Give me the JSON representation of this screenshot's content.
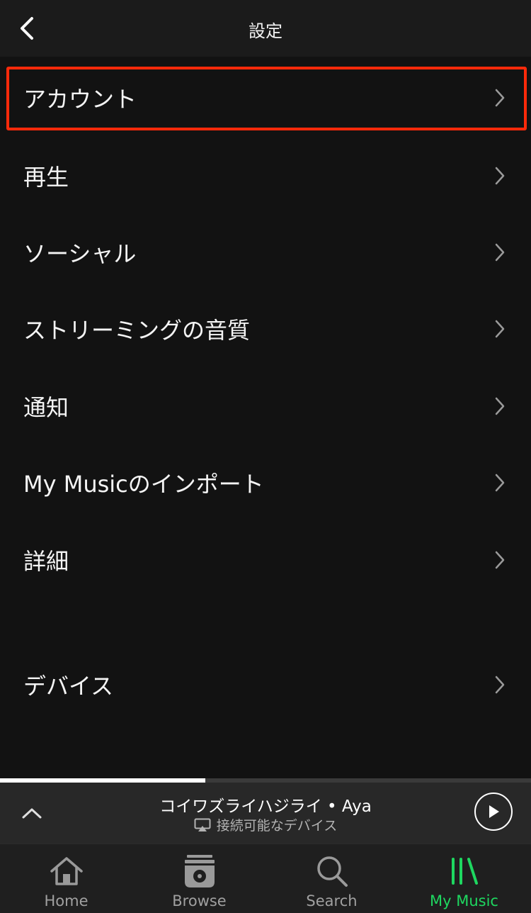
{
  "header": {
    "title": "設定"
  },
  "settings": [
    {
      "label": "アカウント",
      "highlighted": true
    },
    {
      "label": "再生"
    },
    {
      "label": "ソーシャル"
    },
    {
      "label": "ストリーミングの音質"
    },
    {
      "label": "通知"
    },
    {
      "label": "My Musicのインポート"
    },
    {
      "label": "詳細"
    },
    {
      "label": "デバイス"
    }
  ],
  "now_playing": {
    "title": "コイワズライハジライ • Aya",
    "device": "接続可能なデバイス",
    "progress": 0.387
  },
  "tabs": [
    {
      "label": "Home",
      "icon": "home-icon"
    },
    {
      "label": "Browse",
      "icon": "browse-icon"
    },
    {
      "label": "Search",
      "icon": "search-icon"
    },
    {
      "label": "My Music",
      "icon": "my-music-icon",
      "active": true
    }
  ],
  "colors": {
    "background": "#121212",
    "highlight": "#ff2a0a",
    "accent": "#1ed760"
  }
}
